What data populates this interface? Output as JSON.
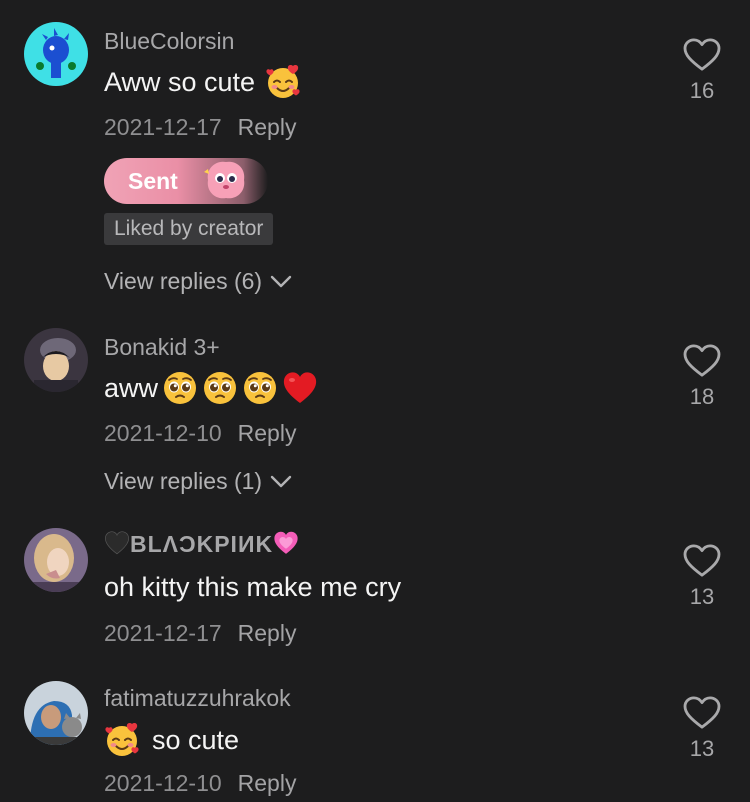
{
  "comments": [
    {
      "username": "BlueColorsin",
      "text": "Aww so cute",
      "date": "2021-12-17",
      "reply_label": "Reply",
      "likes": "16",
      "gift_label": "Sent",
      "liked_badge": "Liked by creator",
      "view_replies": "View replies (6)"
    },
    {
      "username": "Bonakid 3+",
      "text": "aww",
      "date": "2021-12-10",
      "reply_label": "Reply",
      "likes": "18",
      "view_replies": "View replies (1)"
    },
    {
      "username": "BLΛƆKPIИK",
      "text": "oh kitty this make me cry",
      "date": "2021-12-17",
      "reply_label": "Reply",
      "likes": "13"
    },
    {
      "username": "fatimatuzzuhrakok",
      "text": "so cute",
      "date": "2021-12-10",
      "reply_label": "Reply",
      "likes": "13"
    }
  ],
  "icons": {
    "like": "heart-outline-icon",
    "expand": "chevron-down-icon",
    "emoji_smiling_hearts": "smiling-face-with-hearts-emoji",
    "emoji_pleading": "pleading-face-emoji",
    "emoji_red_heart": "red-heart-emoji",
    "emoji_black_heart": "black-heart-emoji",
    "emoji_pink_heart": "growing-heart-emoji"
  },
  "colors": {
    "background": "#1d1d1e",
    "username": "#a7a7a9",
    "text": "#f4f4f4",
    "gift_pill": "#ea8fa6"
  }
}
